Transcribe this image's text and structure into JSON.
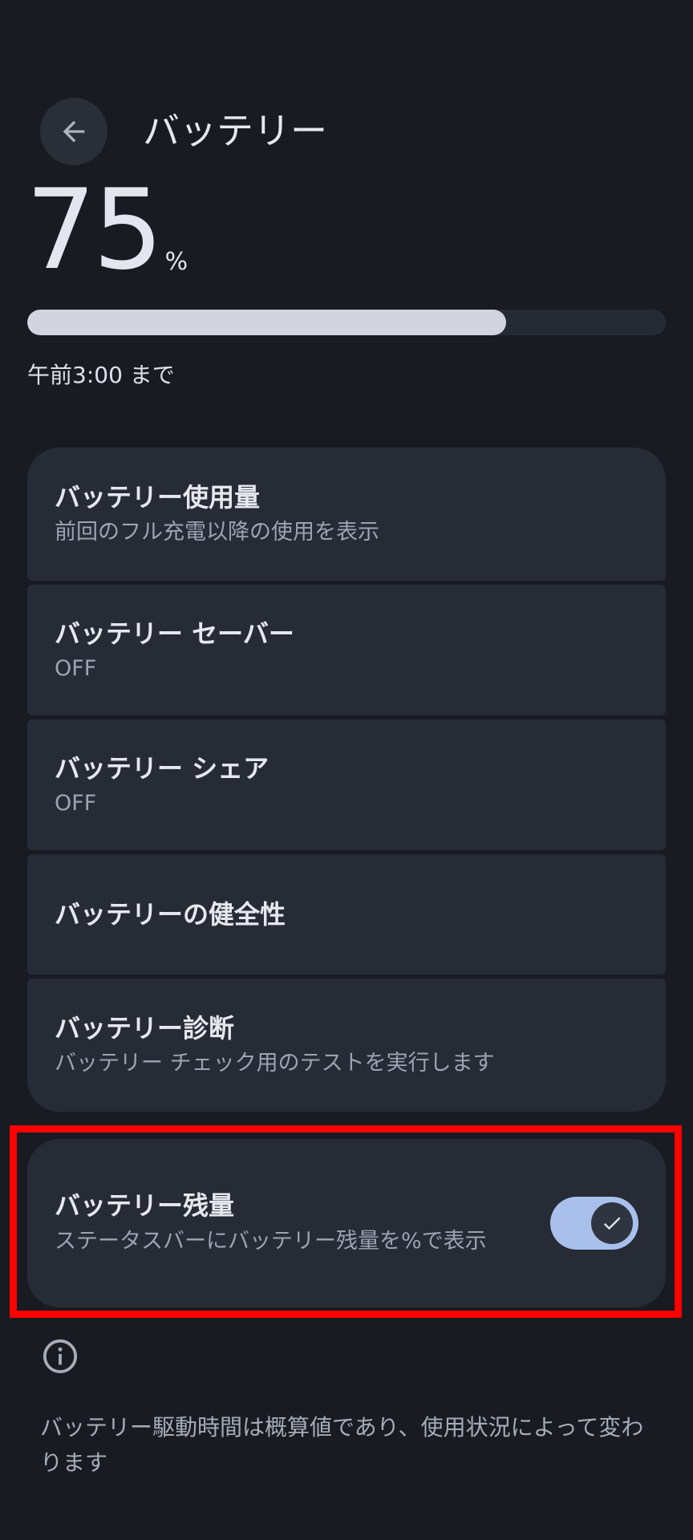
{
  "header": {
    "title": "バッテリー",
    "back_icon": "arrow-left-icon"
  },
  "battery": {
    "level_value": "75",
    "level_unit": "%",
    "level_fraction": 0.75,
    "until_text": "午前3:00 まで"
  },
  "settings": {
    "items": [
      {
        "title": "バッテリー使用量",
        "subtitle": "前回のフル充電以降の使用を表示"
      },
      {
        "title": "バッテリー セーバー",
        "subtitle": "OFF"
      },
      {
        "title": "バッテリー シェア",
        "subtitle": "OFF"
      },
      {
        "title": "バッテリーの健全性",
        "subtitle": ""
      },
      {
        "title": "バッテリー診断",
        "subtitle": "バッテリー チェック用のテストを実行します"
      }
    ]
  },
  "battery_percentage": {
    "title": "バッテリー残量",
    "description": "ステータスバーにバッテリー残量を%で表示",
    "enabled": true
  },
  "footer": {
    "info_icon": "info-icon",
    "text": "バッテリー駆動時間は概算値であり、使用状況によって変わります"
  },
  "colors": {
    "background": "#181b21",
    "card": "#272b35",
    "switch_on": "#a9c0ec",
    "highlight": "#ff0000"
  }
}
